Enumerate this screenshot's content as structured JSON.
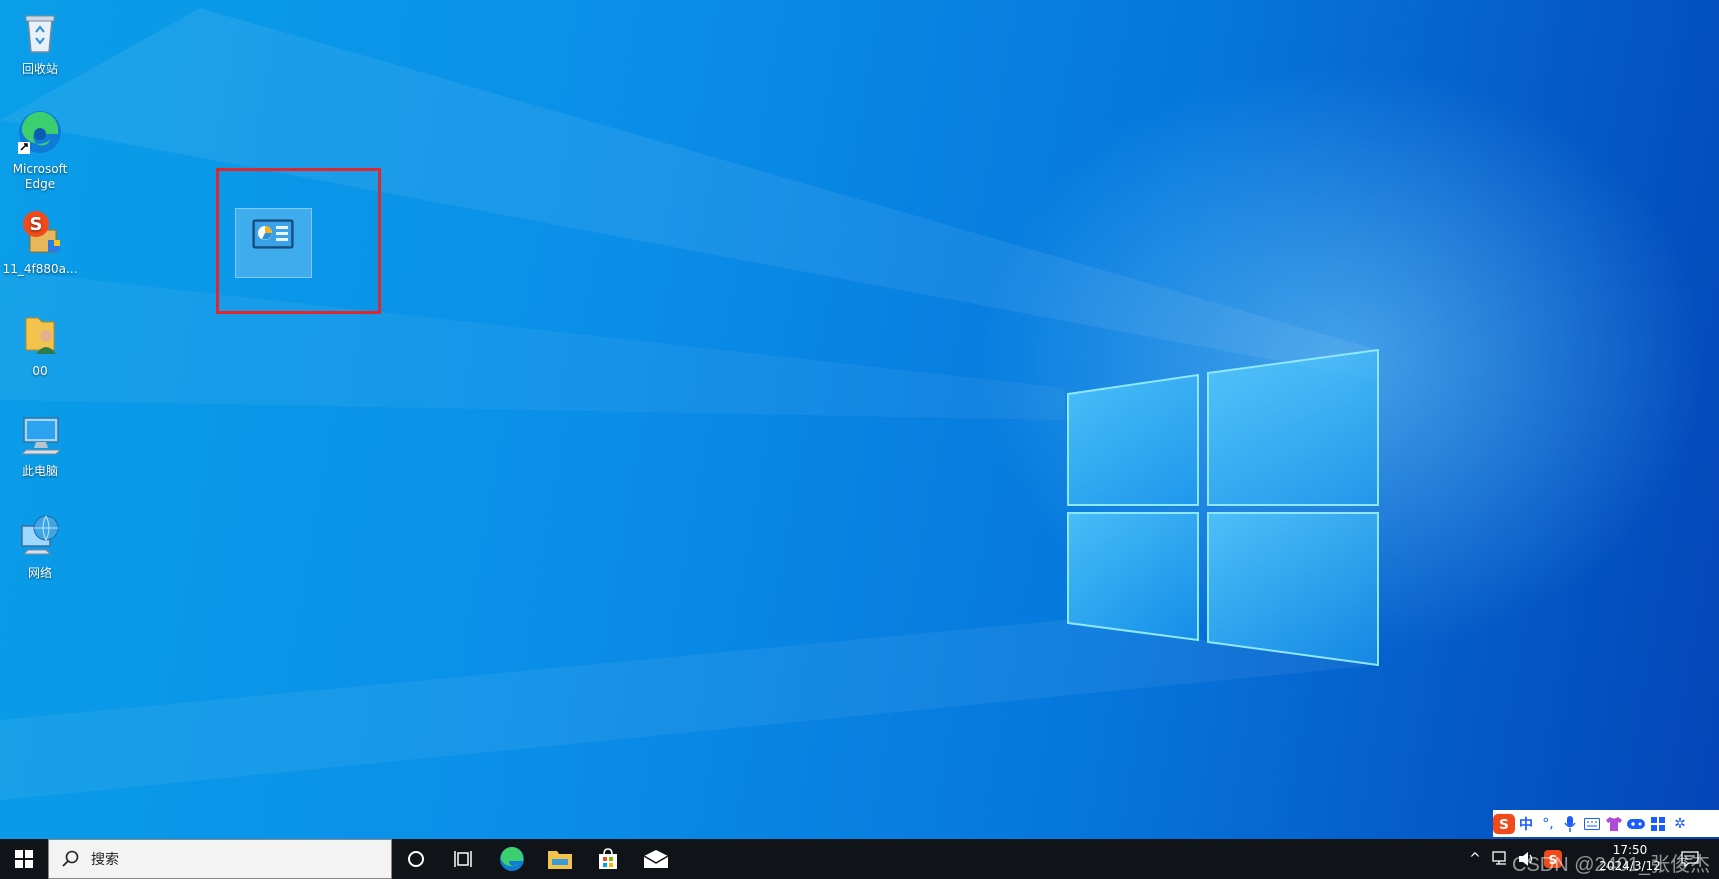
{
  "desktop": {
    "icons": [
      {
        "label": "回收站",
        "icon": "recycle-bin-icon"
      },
      {
        "label": "Microsoft Edge",
        "icon": "edge-icon"
      },
      {
        "label": "11_4f880a...",
        "icon": "sogou-installer-icon"
      },
      {
        "label": "00",
        "icon": "user-folder-icon"
      },
      {
        "label": "此电脑",
        "icon": "this-pc-icon"
      },
      {
        "label": "网络",
        "icon": "network-icon"
      }
    ],
    "selected_icon": "control-panel-icon",
    "highlight_color": "#e0272b"
  },
  "ime_toolbar": {
    "items": [
      "S",
      "中",
      "°,",
      "mic",
      "keyboard",
      "shirt",
      "gamepad",
      "grid",
      "gear"
    ],
    "mode_label": "中"
  },
  "taskbar": {
    "start": "windows-logo-icon",
    "search_placeholder": "搜索",
    "pinned": [
      "cortana-icon",
      "task-view-icon",
      "edge-icon",
      "file-explorer-icon",
      "store-icon",
      "mail-icon"
    ],
    "tray": {
      "chevron": "^",
      "clock_time": "17:50",
      "clock_date": "2024/3/12",
      "watermark": "CSDN @2401_张俊杰"
    }
  }
}
